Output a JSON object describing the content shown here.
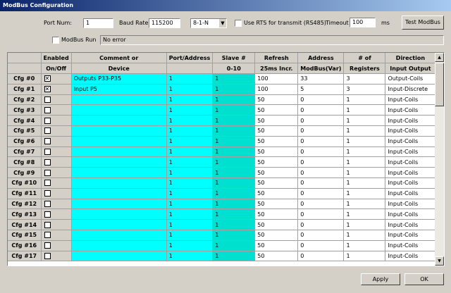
{
  "window": {
    "title": "ModBus Configuration"
  },
  "settings": {
    "port_label": "Port Num:",
    "port_value": "1",
    "baud_label": "Baud Rate:",
    "baud_value": "115200",
    "format_value": "8-1-N",
    "rts_label": "Use RTS for transmit (RS485)",
    "rts_checked": false,
    "timeout_label": "Timeout",
    "timeout_value": "100",
    "timeout_unit": "ms",
    "test_button": "Test ModBus",
    "run_label": "ModBus Run",
    "run_checked": false,
    "status_text": "No error"
  },
  "table": {
    "headers_top": [
      "",
      "Enabled",
      "Comment or",
      "Port/Address",
      "Slave #",
      "Refresh",
      "Address",
      "# of",
      "Direction"
    ],
    "headers_bottom": [
      "",
      "On/Off",
      "Device",
      "",
      "0-10",
      "25ms Incr.",
      "ModBus(Var)",
      "Registers",
      "Input Output"
    ],
    "rows": [
      {
        "cfg": "Cfg #0",
        "enabled": true,
        "comment": "Outputs P33-P35",
        "port": "1",
        "slave": "1",
        "refresh": "100",
        "address": "33",
        "registers": "3",
        "direction": "Output-Coils"
      },
      {
        "cfg": "Cfg #1",
        "enabled": true,
        "comment": "Input P5",
        "port": "1",
        "slave": "1",
        "refresh": "100",
        "address": "5",
        "registers": "3",
        "direction": "Input-Discrete"
      },
      {
        "cfg": "Cfg #2",
        "enabled": false,
        "comment": "",
        "port": "1",
        "slave": "1",
        "refresh": "50",
        "address": "0",
        "registers": "1",
        "direction": "Input-Coils"
      },
      {
        "cfg": "Cfg #3",
        "enabled": false,
        "comment": "",
        "port": "1",
        "slave": "1",
        "refresh": "50",
        "address": "0",
        "registers": "1",
        "direction": "Input-Coils"
      },
      {
        "cfg": "Cfg #4",
        "enabled": false,
        "comment": "",
        "port": "1",
        "slave": "1",
        "refresh": "50",
        "address": "0",
        "registers": "1",
        "direction": "Input-Coils"
      },
      {
        "cfg": "Cfg #5",
        "enabled": false,
        "comment": "",
        "port": "1",
        "slave": "1",
        "refresh": "50",
        "address": "0",
        "registers": "1",
        "direction": "Input-Coils"
      },
      {
        "cfg": "Cfg #6",
        "enabled": false,
        "comment": "",
        "port": "1",
        "slave": "1",
        "refresh": "50",
        "address": "0",
        "registers": "1",
        "direction": "Input-Coils"
      },
      {
        "cfg": "Cfg #7",
        "enabled": false,
        "comment": "",
        "port": "1",
        "slave": "1",
        "refresh": "50",
        "address": "0",
        "registers": "1",
        "direction": "Input-Coils"
      },
      {
        "cfg": "Cfg #8",
        "enabled": false,
        "comment": "",
        "port": "1",
        "slave": "1",
        "refresh": "50",
        "address": "0",
        "registers": "1",
        "direction": "Input-Coils"
      },
      {
        "cfg": "Cfg #9",
        "enabled": false,
        "comment": "",
        "port": "1",
        "slave": "1",
        "refresh": "50",
        "address": "0",
        "registers": "1",
        "direction": "Input-Coils"
      },
      {
        "cfg": "Cfg #10",
        "enabled": false,
        "comment": "",
        "port": "1",
        "slave": "1",
        "refresh": "50",
        "address": "0",
        "registers": "1",
        "direction": "Input-Coils"
      },
      {
        "cfg": "Cfg #11",
        "enabled": false,
        "comment": "",
        "port": "1",
        "slave": "1",
        "refresh": "50",
        "address": "0",
        "registers": "1",
        "direction": "Input-Coils"
      },
      {
        "cfg": "Cfg #12",
        "enabled": false,
        "comment": "",
        "port": "1",
        "slave": "1",
        "refresh": "50",
        "address": "0",
        "registers": "1",
        "direction": "Input-Coils"
      },
      {
        "cfg": "Cfg #13",
        "enabled": false,
        "comment": "",
        "port": "1",
        "slave": "1",
        "refresh": "50",
        "address": "0",
        "registers": "1",
        "direction": "Input-Coils"
      },
      {
        "cfg": "Cfg #14",
        "enabled": false,
        "comment": "",
        "port": "1",
        "slave": "1",
        "refresh": "50",
        "address": "0",
        "registers": "1",
        "direction": "Input-Coils"
      },
      {
        "cfg": "Cfg #15",
        "enabled": false,
        "comment": "",
        "port": "1",
        "slave": "1",
        "refresh": "50",
        "address": "0",
        "registers": "1",
        "direction": "Input-Coils"
      },
      {
        "cfg": "Cfg #16",
        "enabled": false,
        "comment": "",
        "port": "1",
        "slave": "1",
        "refresh": "50",
        "address": "0",
        "registers": "1",
        "direction": "Input-Coils"
      },
      {
        "cfg": "Cfg #17",
        "enabled": false,
        "comment": "",
        "port": "1",
        "slave": "1",
        "refresh": "50",
        "address": "0",
        "registers": "1",
        "direction": "Input-Coils"
      }
    ]
  },
  "footer": {
    "apply_button": "Apply",
    "ok_button": "OK"
  },
  "colors": {
    "cyan": "#00ffff",
    "teal": "#00e0d0",
    "face": "#d4d0c8",
    "title": "#0a246a"
  }
}
